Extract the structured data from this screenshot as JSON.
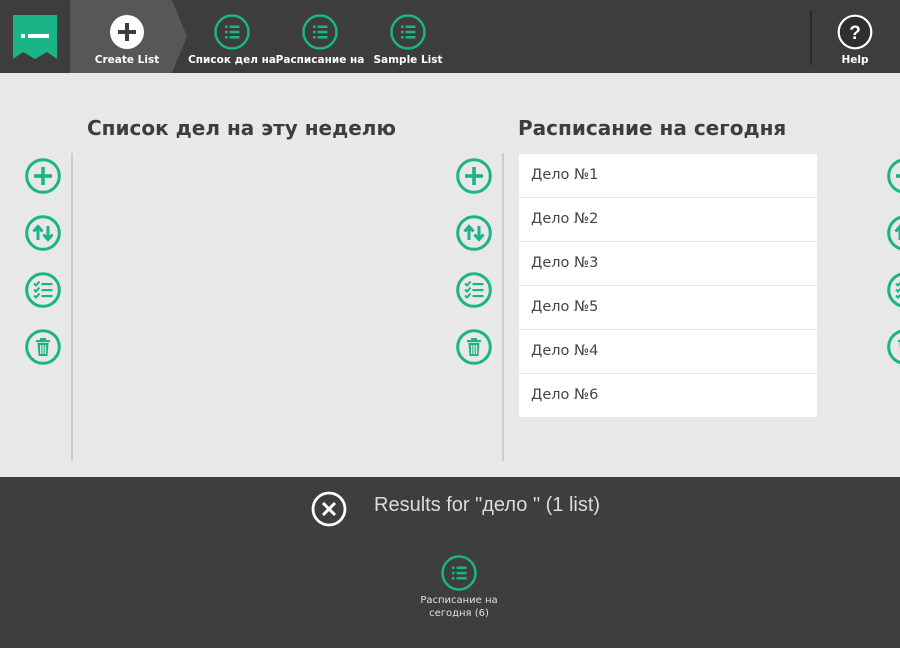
{
  "colors": {
    "accent": "#19b586",
    "topbar": "#3d3d3d",
    "active_tab": "#575757",
    "background": "#e8e8e8",
    "panel": "#3e3e3e"
  },
  "topbar": {
    "logo_icon": "notepad-logo-icon",
    "create_label": "Create List",
    "lists": [
      {
        "label": "Список дел на",
        "icon": "list-icon"
      },
      {
        "label": "Расписание на",
        "icon": "list-icon"
      },
      {
        "label": "Sample List",
        "icon": "list-icon"
      }
    ],
    "help_label": "Help",
    "help_glyph": "?"
  },
  "main": {
    "left_title": "Список дел на эту неделю",
    "right_title": "Расписание на сегодня",
    "action_icons": [
      "add-icon",
      "sort-icon",
      "checklist-icon",
      "trash-icon"
    ],
    "right_items": [
      "Дело №1",
      "Дело №2",
      "Дело №3",
      "Дело №5",
      "Дело №4",
      "Дело №6"
    ]
  },
  "results": {
    "text": "Results for \"дело \" (1 list)",
    "items": [
      {
        "label_line1": "Расписание на",
        "label_line2": "сегодня (6)",
        "icon": "list-icon"
      }
    ]
  }
}
